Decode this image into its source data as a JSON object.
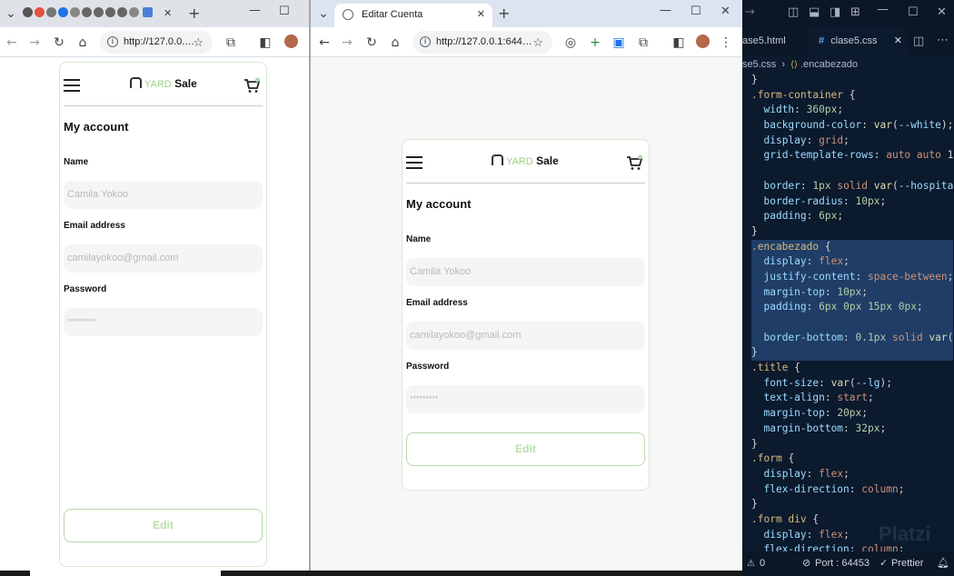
{
  "left_window": {
    "tab_close": "✕",
    "new_tab": "+",
    "url": "http://127.0.0.…",
    "app": {
      "logo_yard": "YARD",
      "logo_sale": "Sale",
      "title": "My account",
      "name_label": "Name",
      "name_value": "Camila Yokoo",
      "email_label": "Email address",
      "email_value": "camilayokoo@gmail.com",
      "password_label": "Password",
      "password_value": "*********",
      "edit_button": "Edit"
    }
  },
  "right_window": {
    "tab_title": "Editar Cuenta",
    "tab_close": "✕",
    "new_tab": "+",
    "url": "http://127.0.0.1:644…",
    "app": {
      "logo_yard": "YARD",
      "logo_sale": "Sale",
      "title": "My account",
      "name_label": "Name",
      "name_value": "Camila Yokoo",
      "email_label": "Email address",
      "email_value": "camilayokoo@gmail.com",
      "password_label": "Password",
      "password_value": "*********",
      "edit_button": "Edit"
    }
  },
  "editor": {
    "tab_prev": "ase5.html",
    "tab_active": "clase5.css",
    "breadcrumb_file": "se5.css",
    "breadcrumb_symbol": ".encabezado",
    "status_errors": "0",
    "status_port": "Port : 64453",
    "status_prettier": "Prettier",
    "watermark": "Platzi",
    "code_lines": [
      "}",
      ".form-container {",
      "  width: 360px;",
      "  background-color: var(--white);",
      "  display: grid;",
      "  grid-template-rows: auto auto 1",
      "",
      "  border: 1px solid var(--hospita",
      "  border-radius: 10px;",
      "  padding: 6px;",
      "}",
      ".encabezado {",
      "  display: flex;",
      "  justify-content: space-between;",
      "  margin-top: 10px;",
      "  padding: 6px 0px 15px 0px;",
      "",
      "  border-bottom: 0.1px solid var(",
      "}",
      ".title {",
      "  font-size: var(--lg);",
      "  text-align: start;",
      "  margin-top: 20px;",
      "  margin-bottom: 32px;",
      "}",
      ".form {",
      "  display: flex;",
      "  flex-direction: column;",
      "}",
      ".form div {",
      "  display: flex;",
      "  flex-direction: column;"
    ]
  },
  "colors": {
    "brand_green": "#acd9b2",
    "editor_bg": "#0c1a2e",
    "selection": "#1f3d66"
  }
}
